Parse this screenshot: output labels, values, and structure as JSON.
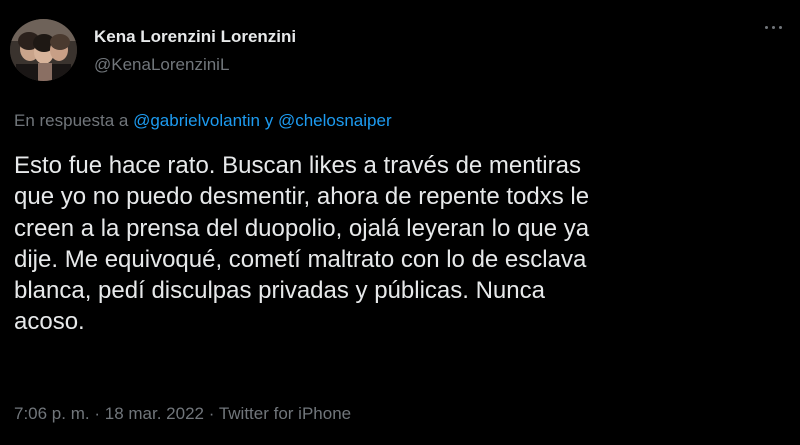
{
  "author": {
    "display_name": "Kena Lorenzini Lorenzini",
    "handle": "@KenaLorenziniL"
  },
  "reply": {
    "prefix": "En respuesta a",
    "mentions": [
      "@gabrielvolantin",
      "@chelosnaiper"
    ],
    "conjunction": "y"
  },
  "tweet": {
    "text": "Esto fue hace rato. Buscan likes a través de mentiras\nque yo no puedo desmentir, ahora de repente todxs le\ncreen a la prensa del duopolio, ojalá leyeran lo que ya\ndije. Me equivoqué, cometí maltrato con lo de esclava\nblanca, pedí disculpas privadas y públicas. Nunca\nacoso."
  },
  "meta": {
    "time": "7:06 p. m.",
    "separator": "·",
    "date": "18 mar. 2022",
    "source": "Twitter for iPhone"
  },
  "icons": {
    "more": "more-dots-icon"
  },
  "colors": {
    "background": "#000000",
    "text": "#e7e9ea",
    "secondary": "#71767b",
    "link": "#1d9bf0"
  }
}
